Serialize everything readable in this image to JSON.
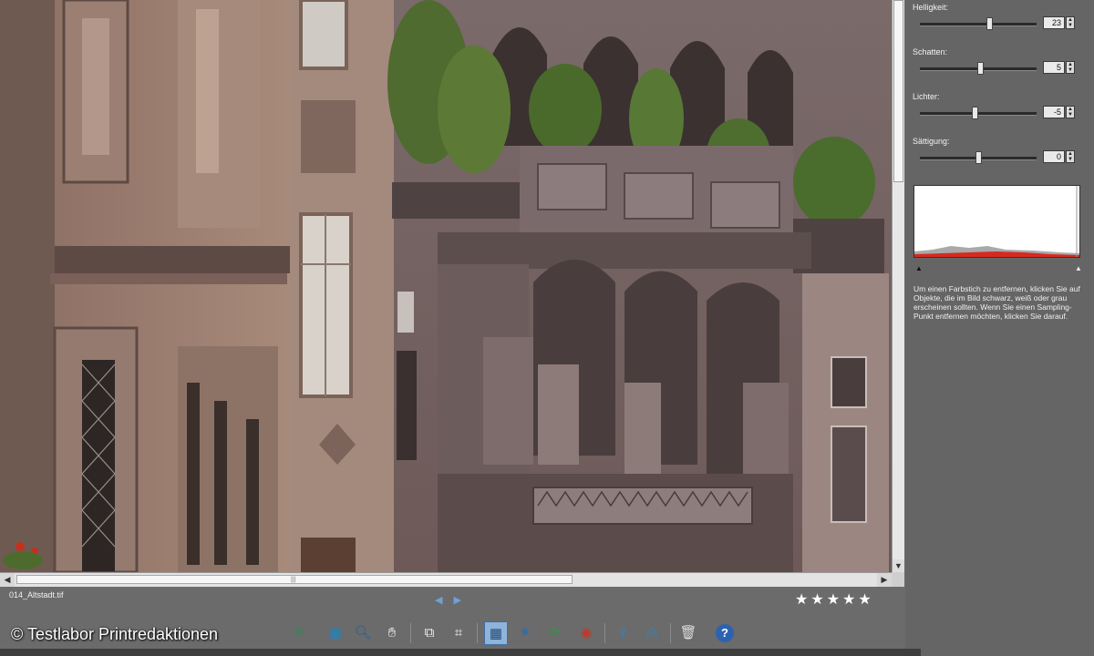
{
  "photo": {
    "file_name": "014_Altstadt.tif"
  },
  "panel": {
    "sliders": [
      {
        "label": "Helligkeit:",
        "value": "23",
        "level": 0.6
      },
      {
        "label": "Schatten:",
        "value": "5",
        "level": 0.52
      },
      {
        "label": "Lichter:",
        "value": "-5",
        "level": 0.47
      },
      {
        "label": "Sättigung:",
        "value": "0",
        "level": 0.5
      }
    ],
    "hint_text": "Um einen Farbstich zu entfernen, klicken Sie auf Objekte, die im Bild schwarz, weiß oder grau erscheinen sollten. Wenn Sie einen Sampling-Punkt entfernen möchten, klicken Sie darauf."
  },
  "rating": {
    "stars": 5
  },
  "toolbar": {
    "icons": [
      "retouch-icon",
      "monitor-icon",
      "zoom-icon",
      "hand-icon",
      "frame-icon",
      "crop-icon",
      "color-correction-icon",
      "magic-wand-icon",
      "rotate-icon",
      "red-eye-icon",
      "export-icon",
      "print-icon",
      "trash-icon",
      "help-icon"
    ],
    "active": "color-correction-icon"
  },
  "watermark": "© Testlabor Printredaktionen",
  "colors": {
    "panel_bg": "#656565",
    "accent": "#8fb3d9",
    "histogram_red": "#d62a20"
  }
}
